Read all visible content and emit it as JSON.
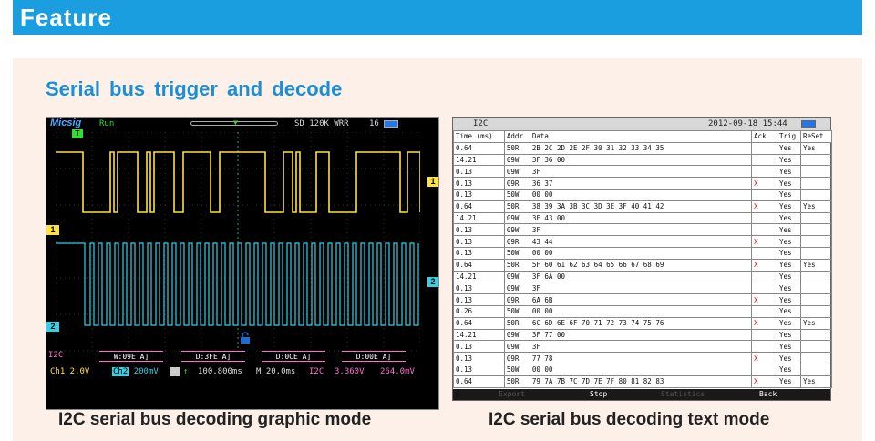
{
  "header": {
    "title": "Feature"
  },
  "section": {
    "title": "Serial bus trigger and decode"
  },
  "scope": {
    "brand": "Micsig",
    "status": "Run",
    "memory": "SD  120K WRR",
    "battery": "16",
    "marker_ch1": "1",
    "marker_ch2": "2",
    "marker_trig": "T",
    "decode_label": "I2C",
    "frames": [
      "W:09E A]",
      "D:3FE A]",
      "D:0CE A]",
      "D:00E A]"
    ],
    "footer": {
      "ch1": "Ch1 2.0V",
      "ch2_tag": "Ch2",
      "ch2_val": "200mV",
      "position": "100.800ms",
      "timebase": "M 20.0ms",
      "bus": "I2C",
      "level": "3.360V",
      "level_mv": "264.0mV"
    },
    "colors": {
      "ch1": "#ffe23a",
      "ch2": "#33d0e8",
      "decode": "#ff6fd0"
    }
  },
  "table": {
    "protocol": "I2C",
    "timestamp": "2012-09-18 15:44",
    "columns": [
      "Time (ms)",
      "Addr",
      "Data",
      "Ack",
      "Trig",
      "ReSet"
    ],
    "rows": [
      [
        "0.64",
        "50R",
        "2B 2C 2D 2E 2F 30 31 32 33 34 35",
        "",
        "Yes",
        "Yes"
      ],
      [
        "14.21",
        "09W",
        "3F 36 00",
        "",
        "Yes",
        ""
      ],
      [
        "0.13",
        "09W",
        "3F",
        "",
        "Yes",
        ""
      ],
      [
        "0.13",
        "09R",
        "36 37",
        "X",
        "Yes",
        ""
      ],
      [
        "0.13",
        "50W",
        "00 00",
        "",
        "Yes",
        ""
      ],
      [
        "0.64",
        "50R",
        "38 39 3A 3B 3C 3D 3E 3F 40 41 42",
        "X",
        "Yes",
        "Yes"
      ],
      [
        "14.21",
        "09W",
        "3F 43 00",
        "",
        "Yes",
        ""
      ],
      [
        "0.13",
        "09W",
        "3F",
        "",
        "Yes",
        ""
      ],
      [
        "0.13",
        "09R",
        "43 44",
        "X",
        "Yes",
        ""
      ],
      [
        "0.13",
        "50W",
        "00 00",
        "",
        "Yes",
        ""
      ],
      [
        "0.64",
        "50R",
        "5F 60 61 62 63 64 65 66 67 68 69",
        "X",
        "Yes",
        "Yes"
      ],
      [
        "14.21",
        "09W",
        "3F 6A 00",
        "",
        "Yes",
        ""
      ],
      [
        "0.13",
        "09W",
        "3F",
        "",
        "Yes",
        ""
      ],
      [
        "0.13",
        "09R",
        "6A 6B",
        "X",
        "Yes",
        ""
      ],
      [
        "0.26",
        "50W",
        "00 00",
        "",
        "Yes",
        ""
      ],
      [
        "0.64",
        "50R",
        "6C 6D 6E 6F 70 71 72 73 74 75 76",
        "X",
        "Yes",
        "Yes"
      ],
      [
        "14.21",
        "09W",
        "3F 77 00",
        "",
        "Yes",
        ""
      ],
      [
        "0.13",
        "09W",
        "3F",
        "",
        "Yes",
        ""
      ],
      [
        "0.13",
        "09R",
        "77 78",
        "X",
        "Yes",
        ""
      ],
      [
        "0.13",
        "50W",
        "00 00",
        "",
        "Yes",
        ""
      ],
      [
        "0.64",
        "50R",
        "79 7A 7B 7C 7D 7E 7F 80 81 82 83",
        "X",
        "Yes",
        "Yes"
      ]
    ],
    "buttons": {
      "export": "Export",
      "stop": "Stop",
      "statistics": "Statistics",
      "back": "Back"
    }
  },
  "captions": {
    "graphic": "I2C serial bus decoding graphic mode",
    "text": "I2C serial bus decoding text mode"
  }
}
